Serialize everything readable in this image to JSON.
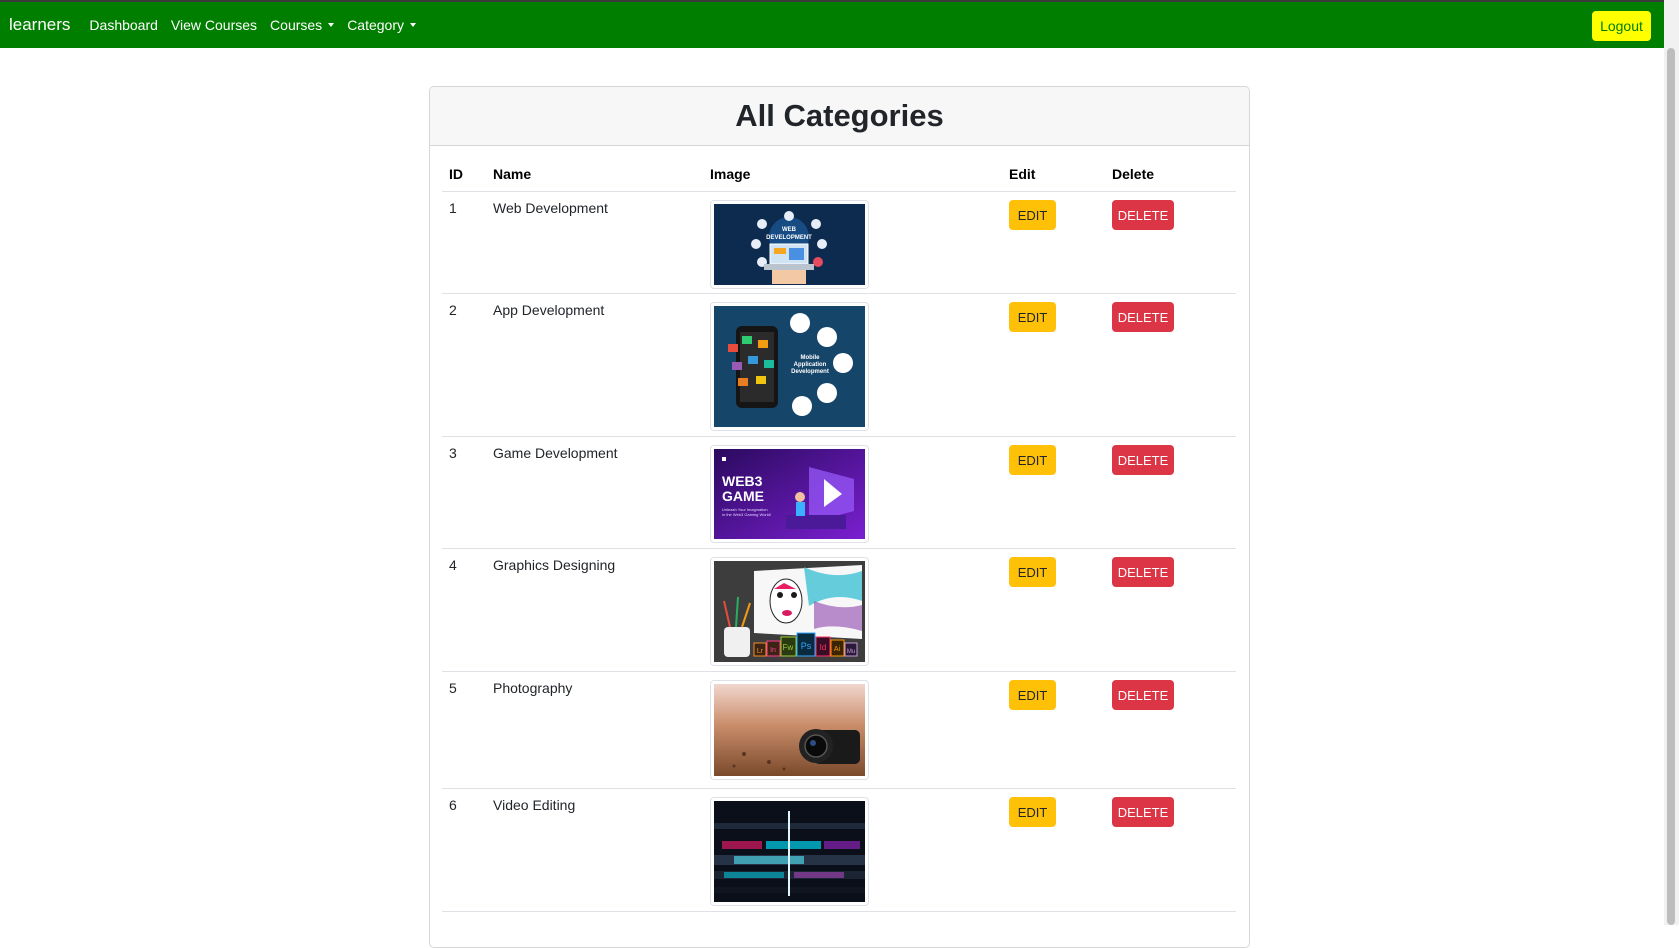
{
  "navbar": {
    "brand": "learners",
    "links": [
      "Dashboard",
      "View Courses"
    ],
    "dropdowns": [
      "Courses",
      "Category"
    ],
    "logout": "Logout",
    "bg_color": "#007e00",
    "logout_color": "#ffff00"
  },
  "page": {
    "title": "All Categories"
  },
  "table": {
    "headers": [
      "ID",
      "Name",
      "Image",
      "Edit",
      "Delete"
    ],
    "rows": [
      {
        "id": "1",
        "name": "Web Development",
        "image": "web-development-thumbnail",
        "edit": "EDIT",
        "delete": "DELETE"
      },
      {
        "id": "2",
        "name": "App Development",
        "image": "app-development-thumbnail",
        "edit": "EDIT",
        "delete": "DELETE"
      },
      {
        "id": "3",
        "name": "Game Development",
        "image": "game-development-thumbnail",
        "edit": "EDIT",
        "delete": "DELETE"
      },
      {
        "id": "4",
        "name": "Graphics Designing",
        "image": "graphics-designing-thumbnail",
        "edit": "EDIT",
        "delete": "DELETE"
      },
      {
        "id": "5",
        "name": "Photography",
        "image": "photography-thumbnail",
        "edit": "EDIT",
        "delete": "DELETE"
      },
      {
        "id": "6",
        "name": "Video Editing",
        "image": "video-editing-thumbnail",
        "edit": "EDIT",
        "delete": "DELETE"
      }
    ]
  },
  "thumbnails": {
    "web": {
      "text_line1": "WEB",
      "text_line2": "DEVELOPMENT"
    },
    "app": {
      "text_line1": "Mobile",
      "text_line2": "Application",
      "text_line3": "Development"
    },
    "game": {
      "text_line1": "WEB3",
      "text_line2": "GAME",
      "text_line3": "Unleash Your Imagination",
      "text_line4": "in the Web3 Gaming World!"
    },
    "graphics": {
      "apps": [
        "Lr",
        "In",
        "Fw",
        "Ps",
        "Id",
        "Ai",
        "Mu"
      ]
    }
  },
  "colors": {
    "edit": "#ffc107",
    "delete": "#dc3545"
  }
}
